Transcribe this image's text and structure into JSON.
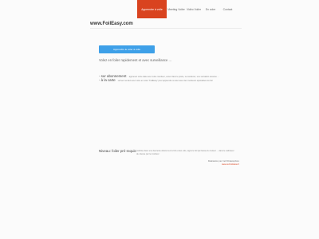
{
  "nav": {
    "items": [
      {
        "label": "Apprendre à voile"
      },
      {
        "label": "Meeting Voiler"
      },
      {
        "label": "Vidéo Voiler"
      },
      {
        "label": "En voler"
      },
      {
        "label": "Contact"
      }
    ]
  },
  "header": {
    "site_title": "www.FoilEasy.com"
  },
  "main": {
    "cta_label": "Apprendre le voler à voile",
    "intro": "Volez en foiler rapidement et avec surveillance ...",
    "bullets": [
      {
        "head": "- sur abonnement",
        "text": ": apprenez votre date avec notre moniteur, venez dans le poste, se canderez, une sensation assurée ..."
      },
      {
        "head": "- à la carte",
        "text": ": arrivez rendez avec votre en voler \"FoilEasy\" pour apprendre à voler avec des moniteurs spécialisés du foil"
      }
    ],
    "section_title": "Niveau: foiler pré-requis",
    "section_text": "maîtrise dans une descente debout sur le foil et des vols, signé le foil par basse du moteur ... dans le catheteur de vitesse par le moniteur"
  },
  "footer": {
    "credit": "Réalisation par Cerfi Drakosphère",
    "link": "www.cerfi-drakos.fr"
  },
  "colors": {
    "accent": "#d9431f",
    "cta": "#3ea0e8"
  }
}
